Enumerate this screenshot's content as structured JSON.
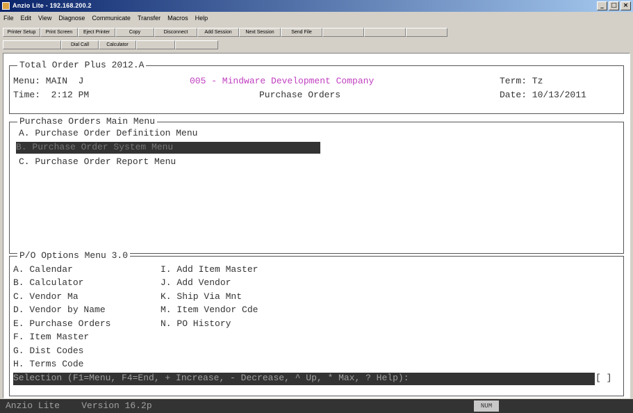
{
  "window": {
    "title": "Anzio Lite - 192.168.200.2"
  },
  "menubar": [
    "File",
    "Edit",
    "View",
    "Diagnose",
    "Communicate",
    "Transfer",
    "Macros",
    "Help"
  ],
  "toolbar": {
    "row1": [
      {
        "label": "Printer Setup",
        "enabled": true
      },
      {
        "label": "Print Screen",
        "enabled": true
      },
      {
        "label": "Eject Printer",
        "enabled": true
      },
      {
        "label": "Copy",
        "enabled": true
      },
      {
        "label": "Disconnect",
        "enabled": true
      },
      {
        "label": "Add Session",
        "enabled": true
      },
      {
        "label": "Next Session",
        "enabled": true
      },
      {
        "label": "Send File",
        "enabled": true
      },
      {
        "label": "",
        "enabled": false
      },
      {
        "label": "",
        "enabled": false
      },
      {
        "label": "",
        "enabled": false
      }
    ],
    "row2": [
      {
        "label": "",
        "enabled": false
      },
      {
        "label": "Dial Call",
        "enabled": true
      },
      {
        "label": "Calculator",
        "enabled": true
      },
      {
        "label": "",
        "enabled": false
      },
      {
        "label": "",
        "enabled": false
      }
    ]
  },
  "header": {
    "product": "Total Order Plus 2012.A",
    "menu_label": "Menu: MAIN  J",
    "company": "005 - Mindware Development Company",
    "term": "Term: Tz",
    "time": "Time:  2:12 PM",
    "screen_title": "Purchase Orders",
    "date": "Date: 10/13/2011"
  },
  "main_menu": {
    "title": "Purchase Orders Main Menu",
    "items": [
      {
        "label": "A. Purchase Order Definition Menu"
      },
      {
        "label": "B. Purchase Order System Menu",
        "selected": true
      },
      {
        "label": "C. Purchase Order Report Menu"
      }
    ]
  },
  "options_menu": {
    "title": "P/O Options Menu 3.0",
    "left": [
      "A. Calendar",
      "B. Calculator",
      "C. Vendor Ma",
      "D. Vendor by Name",
      "E. Purchase Orders",
      "F. Item Master",
      "G. Dist Codes",
      "H. Terms Code"
    ],
    "right": [
      "I. Add Item Master",
      "J. Add Vendor",
      "K. Ship Via Mnt",
      "M. Item Vendor Cde",
      "N. PO History"
    ]
  },
  "selection": {
    "prompt": "Selection (F1=Menu, F4=End, + Increase, - Decrease, ^ Up, * Max, ? Help):",
    "value": "[ ]"
  },
  "statusbar": {
    "text": "Anzio Lite    Version 16.2p",
    "indicator": "NUM"
  },
  "colors": {
    "titlebar": "#0a246a",
    "terminal_bg": "#ffffff",
    "terminal_fg": "#333333",
    "company": "#c040c0",
    "highlight": "#333333"
  }
}
